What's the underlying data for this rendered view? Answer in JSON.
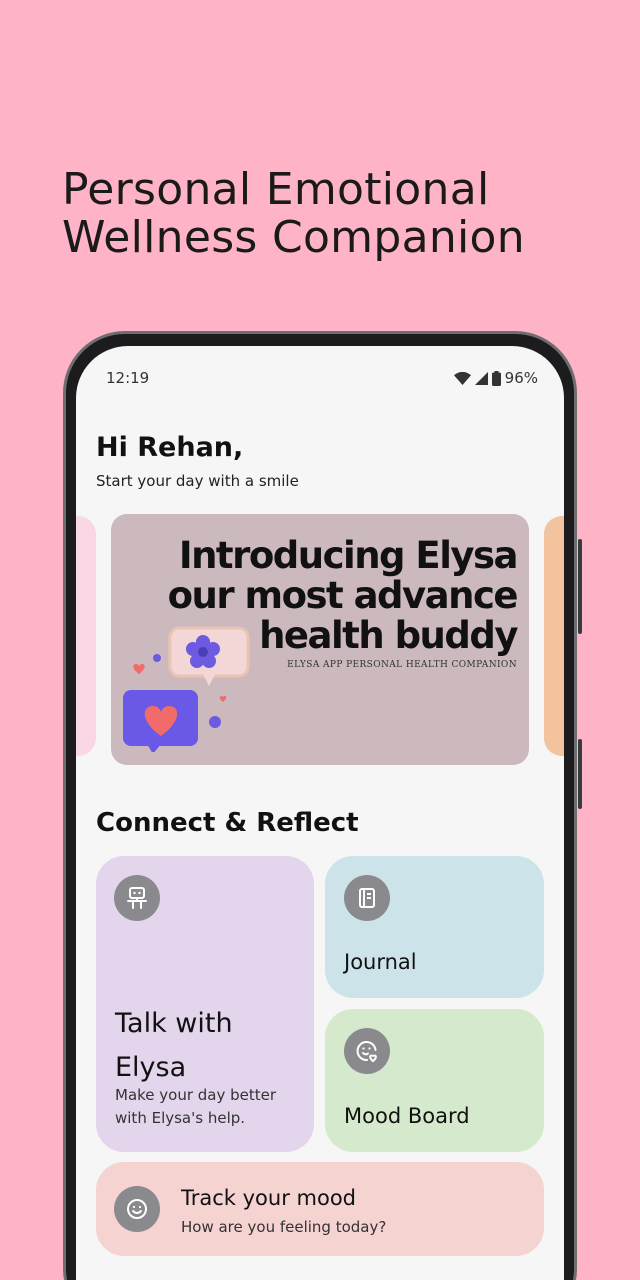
{
  "promo": {
    "title": "Personal Emotional Wellness Companion"
  },
  "status_bar": {
    "time": "12:19",
    "battery": "96%"
  },
  "home": {
    "greeting": "Hi Rehan,",
    "subtitle": "Start your day with a smile"
  },
  "banner": {
    "headline_line1": "Introducing Elysa",
    "headline_line2": "our most advance",
    "headline_line3": "health buddy",
    "caption": "ELYSA APP PERSONAL HEALTH COMPANION"
  },
  "section": {
    "title": "Connect & Reflect"
  },
  "cards": {
    "talk": {
      "title": "Talk with Elysa",
      "subtitle": "Make your day better with Elysa's help.",
      "icon": "robot-icon",
      "color": "#E2D5EC"
    },
    "journal": {
      "title": "Journal",
      "icon": "journal-icon",
      "color": "#CDE3EA"
    },
    "mood_board": {
      "title": "Mood Board",
      "icon": "mood-face-heart-icon",
      "color": "#D5EACC"
    },
    "track": {
      "title": "Track your mood",
      "subtitle": "How are you feeling today?",
      "icon": "smiley-icon",
      "color": "#F5D3D1"
    }
  },
  "colors": {
    "background": "#FFB3C6",
    "screen": "#F6F6F6",
    "banner": "#CBB9BE"
  }
}
